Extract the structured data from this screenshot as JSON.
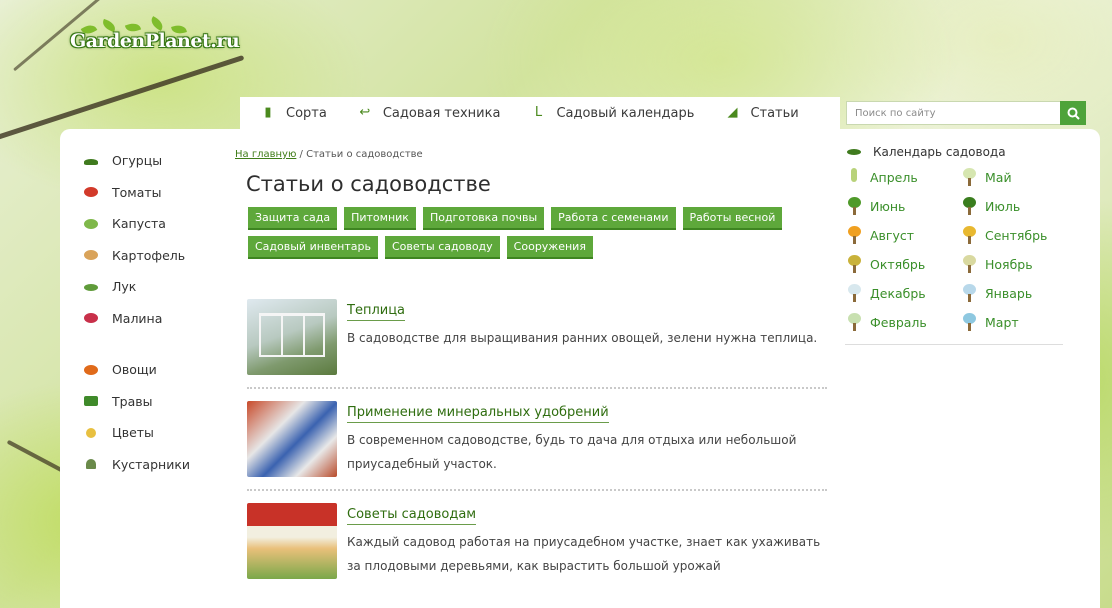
{
  "logo": {
    "text": "GardenPlanet.ru"
  },
  "nav": {
    "items": [
      {
        "label": "Сорта",
        "icon": "seed-packet-icon"
      },
      {
        "label": "Садовая техника",
        "icon": "hose-icon"
      },
      {
        "label": "Садовый календарь",
        "icon": "boot-icon"
      },
      {
        "label": "Статьи",
        "icon": "cucumber-icon"
      }
    ]
  },
  "search": {
    "placeholder": "Поиск по сайту",
    "icon": "search-icon"
  },
  "sidebar": {
    "group1": [
      {
        "label": "Огурцы",
        "icon": "cucumber-icon",
        "color": "#3f7a1e"
      },
      {
        "label": "Томаты",
        "icon": "tomato-icon",
        "color": "#d23a2a"
      },
      {
        "label": "Капуста",
        "icon": "cabbage-icon",
        "color": "#7fb84a"
      },
      {
        "label": "Картофель",
        "icon": "potato-icon",
        "color": "#d9a35a"
      },
      {
        "label": "Лук",
        "icon": "onion-icon",
        "color": "#5f9b3a"
      },
      {
        "label": "Малина",
        "icon": "raspberry-icon",
        "color": "#c8304a"
      }
    ],
    "group2": [
      {
        "label": "Овощи",
        "icon": "pumpkin-icon",
        "color": "#e06a1a"
      },
      {
        "label": "Травы",
        "icon": "herbs-icon",
        "color": "#3f8a2a"
      },
      {
        "label": "Цветы",
        "icon": "flower-icon",
        "color": "#e8c040"
      },
      {
        "label": "Кустарники",
        "icon": "shrub-icon",
        "color": "#6a8a4a"
      }
    ]
  },
  "breadcrumb": {
    "home": "На главную",
    "separator": " / ",
    "current": "Статьи о садоводстве"
  },
  "page_title": "Статьи о садоводстве",
  "tags": [
    "Защита сада",
    "Питомник",
    "Подготовка почвы",
    "Работа с семенами",
    "Работы весной",
    "Садовый инвентарь",
    "Советы садоводу",
    "Сооружения"
  ],
  "articles": [
    {
      "title": "Теплица",
      "text": "В садоводстве для выращивания ранних овощей, зелени нужна теплица.",
      "thumb": "greenhouse"
    },
    {
      "title": "Применение минеральных удобрений",
      "text": "В современном садоводстве, будь то дача для отдыха или небольшой приусадебный участок.",
      "thumb": "fertilizer"
    },
    {
      "title": "Советы садоводам",
      "text": "Каждый садовод работая на приусадебном участке, знает как ухаживать за плодовыми деревьями, как вырастить большой урожай",
      "thumb": "book"
    }
  ],
  "calendar": {
    "title": "Календарь садовода",
    "months": [
      {
        "label": "Апрель",
        "color": "#b8d27a"
      },
      {
        "label": "Май",
        "color": "#d6e6b0"
      },
      {
        "label": "Июнь",
        "color": "#4f9a2a"
      },
      {
        "label": "Июль",
        "color": "#3a7d1e"
      },
      {
        "label": "Август",
        "color": "#f0a020"
      },
      {
        "label": "Сентябрь",
        "color": "#e8b830"
      },
      {
        "label": "Октябрь",
        "color": "#c9b23a"
      },
      {
        "label": "Ноябрь",
        "color": "#d9d9a0"
      },
      {
        "label": "Декабрь",
        "color": "#d8e8ee"
      },
      {
        "label": "Январь",
        "color": "#b8d8ea"
      },
      {
        "label": "Февраль",
        "color": "#c8e0b0"
      },
      {
        "label": "Март",
        "color": "#8ec8e0"
      }
    ]
  }
}
